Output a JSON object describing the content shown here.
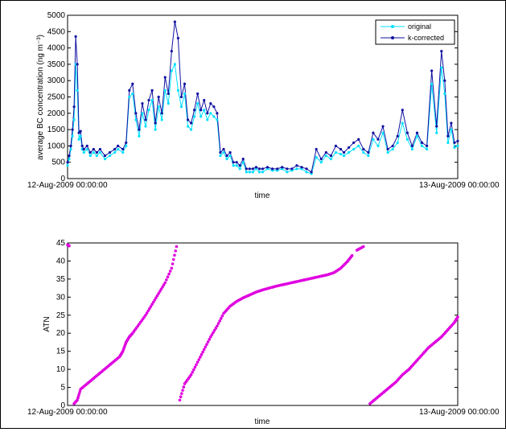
{
  "chart_data": [
    {
      "type": "line",
      "title": "",
      "xlabel": "time",
      "ylabel": "average BC concentration (ng m⁻³)",
      "x_tick_labels": [
        "12-Aug-2009 00:00:00",
        "13-Aug-2009 00:00:00"
      ],
      "xlim": [
        0,
        24
      ],
      "x_units": "hours since 12-Aug-2009 00:00:00",
      "ylim": [
        0,
        5000
      ],
      "y_ticks": [
        0,
        500,
        1000,
        1500,
        2000,
        2500,
        3000,
        3500,
        4000,
        4500,
        5000
      ],
      "legend": {
        "placement": "top-right"
      },
      "series": [
        {
          "name": "original",
          "color": "#00e0ff",
          "marker": "dot",
          "x": [
            0,
            0.1,
            0.2,
            0.3,
            0.4,
            0.5,
            0.6,
            0.7,
            0.8,
            0.9,
            1.0,
            1.2,
            1.4,
            1.6,
            1.8,
            2.0,
            2.3,
            2.6,
            2.9,
            3.1,
            3.4,
            3.6,
            3.8,
            4.0,
            4.2,
            4.4,
            4.6,
            4.8,
            5.0,
            5.2,
            5.4,
            5.6,
            5.8,
            6.0,
            6.2,
            6.4,
            6.6,
            6.8,
            7.0,
            7.2,
            7.4,
            7.6,
            7.8,
            8.0,
            8.2,
            8.4,
            8.6,
            8.8,
            9.0,
            9.2,
            9.4,
            9.6,
            9.8,
            10.0,
            10.2,
            10.4,
            10.6,
            10.8,
            11.0,
            11.2,
            11.4,
            11.6,
            11.8,
            12.0,
            12.3,
            12.6,
            12.9,
            13.2,
            13.5,
            13.8,
            14.1,
            14.4,
            14.7,
            15.0,
            15.3,
            15.6,
            15.9,
            16.2,
            16.5,
            16.8,
            17.0,
            17.3,
            17.6,
            17.9,
            18.2,
            18.5,
            18.8,
            19.1,
            19.4,
            19.7,
            20.0,
            20.3,
            20.6,
            20.9,
            21.2,
            21.5,
            21.8,
            22.1,
            22.4,
            22.7,
            23.0,
            23.2,
            23.4,
            23.6,
            23.8,
            24.0
          ],
          "values": [
            400,
            600,
            900,
            1300,
            1800,
            3500,
            2700,
            1200,
            1300,
            900,
            800,
            900,
            700,
            800,
            700,
            800,
            600,
            700,
            800,
            900,
            800,
            1000,
            2500,
            2600,
            1800,
            1300,
            2000,
            1600,
            2100,
            2400,
            1500,
            2200,
            1800,
            2700,
            2300,
            3300,
            3500,
            2700,
            2200,
            2600,
            1600,
            1500,
            1900,
            2300,
            1900,
            2100,
            1800,
            2000,
            1900,
            1800,
            700,
            800,
            600,
            700,
            400,
            400,
            300,
            500,
            200,
            200,
            200,
            300,
            200,
            200,
            300,
            250,
            250,
            300,
            200,
            250,
            300,
            300,
            200,
            150,
            650,
            500,
            700,
            600,
            800,
            750,
            700,
            800,
            900,
            1000,
            800,
            700,
            1200,
            1000,
            1400,
            800,
            900,
            1100,
            1700,
            1200,
            900,
            1300,
            1000,
            900,
            2900,
            1400,
            3400,
            2600,
            1100,
            1500,
            950,
            1000
          ]
        },
        {
          "name": "k-corrected",
          "color": "#1010a0",
          "marker": "dot",
          "x": [
            0,
            0.1,
            0.2,
            0.3,
            0.4,
            0.5,
            0.6,
            0.7,
            0.8,
            0.9,
            1.0,
            1.2,
            1.4,
            1.6,
            1.8,
            2.0,
            2.3,
            2.6,
            2.9,
            3.1,
            3.4,
            3.6,
            3.8,
            4.0,
            4.2,
            4.4,
            4.6,
            4.8,
            5.0,
            5.2,
            5.4,
            5.6,
            5.8,
            6.0,
            6.2,
            6.4,
            6.6,
            6.8,
            7.0,
            7.2,
            7.4,
            7.6,
            7.8,
            8.0,
            8.2,
            8.4,
            8.6,
            8.8,
            9.0,
            9.2,
            9.4,
            9.6,
            9.8,
            10.0,
            10.2,
            10.4,
            10.6,
            10.8,
            11.0,
            11.2,
            11.4,
            11.6,
            11.8,
            12.0,
            12.3,
            12.6,
            12.9,
            13.2,
            13.5,
            13.8,
            14.1,
            14.4,
            14.7,
            15.0,
            15.3,
            15.6,
            15.9,
            16.2,
            16.5,
            16.8,
            17.0,
            17.3,
            17.6,
            17.9,
            18.2,
            18.5,
            18.8,
            19.1,
            19.4,
            19.7,
            20.0,
            20.3,
            20.6,
            20.9,
            21.2,
            21.5,
            21.8,
            22.1,
            22.4,
            22.7,
            23.0,
            23.2,
            23.4,
            23.6,
            23.8,
            24.0
          ],
          "values": [
            500,
            700,
            1000,
            1500,
            2200,
            4350,
            3500,
            1400,
            1450,
            1000,
            900,
            1000,
            800,
            900,
            800,
            900,
            700,
            800,
            900,
            1000,
            900,
            1100,
            2700,
            2900,
            2000,
            1500,
            2300,
            1800,
            2400,
            2700,
            1700,
            2500,
            2000,
            3100,
            2600,
            3900,
            4800,
            4300,
            2500,
            2900,
            1800,
            1700,
            2100,
            2600,
            2100,
            2400,
            2000,
            2300,
            2200,
            2000,
            800,
            900,
            700,
            800,
            500,
            500,
            400,
            600,
            300,
            300,
            300,
            350,
            300,
            300,
            350,
            300,
            300,
            350,
            300,
            300,
            400,
            350,
            300,
            200,
            900,
            600,
            800,
            700,
            1000,
            900,
            800,
            950,
            1100,
            1200,
            900,
            800,
            1400,
            1200,
            1600,
            900,
            1000,
            1300,
            2100,
            1400,
            1000,
            1400,
            1100,
            1000,
            3300,
            1600,
            3900,
            3000,
            1300,
            1700,
            1100,
            1150
          ]
        }
      ]
    },
    {
      "type": "scatter",
      "title": "",
      "xlabel": "time",
      "ylabel": "ATN",
      "x_tick_labels": [
        "12-Aug-2009 00:00:00",
        "13-Aug-2009 00:00:00"
      ],
      "xlim": [
        0,
        24
      ],
      "x_units": "hours since 12-Aug-2009 00:00:00",
      "ylim": [
        0,
        45
      ],
      "y_ticks": [
        0,
        5,
        10,
        15,
        20,
        25,
        30,
        35,
        40,
        45
      ],
      "grid": false,
      "series": [
        {
          "color": "#e000e0",
          "marker": "dot",
          "segments": [
            {
              "x": [
                0.0,
                0.1,
                0.4,
                0.6,
                0.8,
                1.2,
                1.6,
                2.0,
                2.4,
                2.8,
                3.2,
                3.4,
                3.6,
                3.8,
                4.0,
                4.4,
                4.8,
                5.2,
                5.6,
                6.0,
                6.4,
                6.7
              ],
              "values": [
                44.5,
                44.2,
                0.5,
                1.5,
                4.5,
                6.0,
                7.5,
                9.0,
                10.5,
                12.0,
                13.5,
                15.0,
                17.5,
                19.0,
                20.0,
                22.5,
                25.0,
                28.0,
                31.0,
                34.0,
                38.0,
                44.0
              ]
            },
            {
              "x": [
                6.9,
                7.2,
                7.6,
                8.0,
                8.4,
                8.8,
                9.2,
                9.6,
                10.0,
                10.4,
                10.8,
                11.2,
                11.6,
                12.0,
                12.4,
                12.8,
                13.2,
                13.6,
                14.0,
                14.4,
                14.8,
                15.2,
                15.6,
                16.0,
                16.4,
                16.8,
                17.2,
                17.5
              ],
              "values": [
                1.5,
                6.0,
                8.5,
                12.0,
                15.5,
                19.0,
                22.0,
                25.5,
                27.5,
                28.8,
                29.8,
                30.6,
                31.4,
                32.0,
                32.5,
                33.0,
                33.4,
                33.8,
                34.2,
                34.6,
                35.0,
                35.4,
                35.8,
                36.2,
                36.8,
                38.0,
                39.8,
                41.5
              ]
            },
            {
              "x": [
                17.8,
                18.2,
                18.6,
                19.0,
                19.4,
                19.8,
                20.2,
                20.6,
                21.0,
                21.4,
                21.8,
                22.2,
                22.6,
                23.0,
                23.4,
                23.8,
                24.0
              ],
              "values": [
                43.0,
                44.0,
                0.5,
                2.0,
                3.5,
                5.0,
                6.5,
                8.5,
                10.0,
                12.0,
                14.0,
                16.0,
                17.5,
                19.0,
                21.0,
                23.0,
                24.5
              ]
            }
          ]
        }
      ]
    }
  ]
}
